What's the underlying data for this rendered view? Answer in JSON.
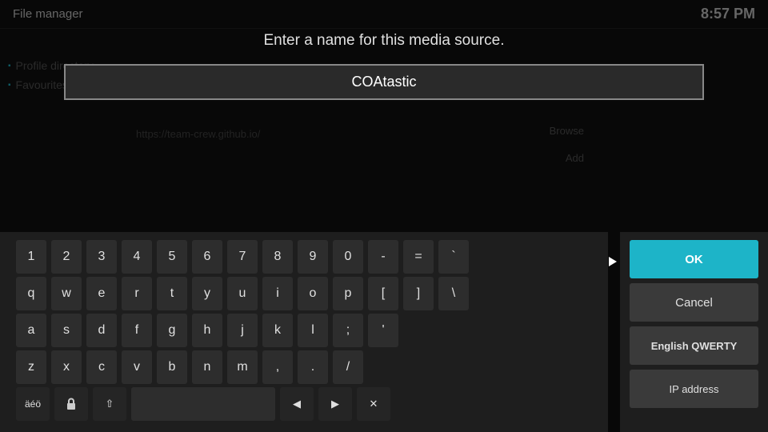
{
  "titlebar": {
    "title": "File manager",
    "time": "8:57 PM"
  },
  "background": {
    "url": "https://team-crew.github.io/",
    "browse_label": "Browse",
    "add_label": "Add",
    "list_items": [
      "Profile directory",
      "Favourites"
    ]
  },
  "dialog": {
    "title": "Enter a name for this media source.",
    "input_value": "COAtastic",
    "input_placeholder": "COAtastic"
  },
  "keyboard": {
    "row1": [
      "1",
      "2",
      "3",
      "4",
      "5",
      "6",
      "7",
      "8",
      "9",
      "0",
      "-",
      "=",
      "`"
    ],
    "row2": [
      "q",
      "w",
      "e",
      "r",
      "t",
      "y",
      "u",
      "i",
      "o",
      "p",
      "[",
      "]",
      "\\"
    ],
    "row3": [
      "a",
      "s",
      "d",
      "f",
      "g",
      "h",
      "j",
      "k",
      "l",
      ";",
      "'"
    ],
    "row4": [
      "z",
      "x",
      "c",
      "v",
      "b",
      "n",
      "m",
      ",",
      ".",
      "/"
    ],
    "row5_special": [
      "äéö",
      "🔒",
      "⇧",
      "",
      "◀",
      "▶",
      "✕"
    ]
  },
  "right_panel": {
    "ok_label": "OK",
    "cancel_label": "Cancel",
    "layout_label": "English QWERTY",
    "ip_label": "IP address"
  }
}
